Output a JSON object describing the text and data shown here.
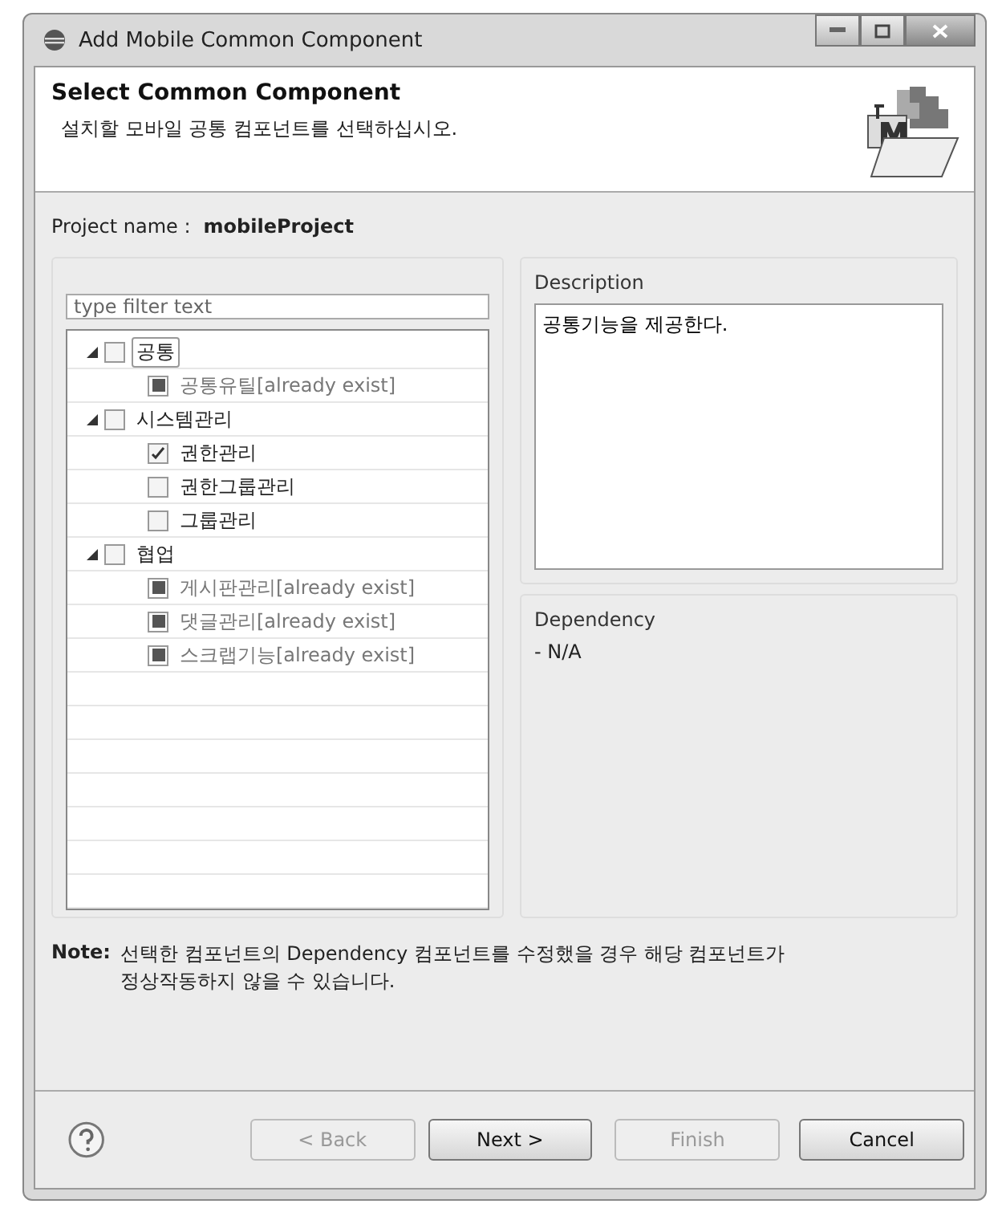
{
  "window": {
    "title": "Add Mobile Common Component"
  },
  "header": {
    "title": "Select Common Component",
    "subtitle": "설치할 모바일 공통 컴포넌트를 선택하십시오."
  },
  "project": {
    "label": "Project name :",
    "value": "mobileProject"
  },
  "filter": {
    "placeholder": "type filter text"
  },
  "tree": [
    {
      "label": "공통",
      "checked": false,
      "exists": false,
      "expanded": true,
      "selected": true,
      "children": [
        {
          "label": "공통유틸[already exist]",
          "exists": true,
          "selected": false
        }
      ]
    },
    {
      "label": "시스템관리",
      "checked": false,
      "exists": false,
      "expanded": true,
      "selected": false,
      "children": [
        {
          "label": "권한관리",
          "checked": true,
          "exists": false,
          "selected": false
        },
        {
          "label": "권한그룹관리",
          "checked": false,
          "exists": false,
          "selected": false
        },
        {
          "label": "그룹관리",
          "checked": false,
          "exists": false,
          "selected": false
        }
      ]
    },
    {
      "label": "협업",
      "checked": false,
      "exists": false,
      "expanded": true,
      "selected": false,
      "children": [
        {
          "label": "게시판관리[already exist]",
          "exists": true,
          "selected": false
        },
        {
          "label": "댓글관리[already exist]",
          "exists": true,
          "selected": false
        },
        {
          "label": "스크랩기능[already exist]",
          "exists": true,
          "selected": false
        }
      ]
    }
  ],
  "description": {
    "label": "Description",
    "text": "공통기능을 제공한다."
  },
  "dependency": {
    "label": "Dependency",
    "text": "- N/A"
  },
  "note": {
    "label": "Note:",
    "text": "선택한 컴포넌트의 Dependency 컴포넌트를 수정했을 경우 해당 컴포넌트가 정상작동하지 않을 수 있습니다."
  },
  "buttons": [
    {
      "label": "< Back",
      "disabled": true
    },
    {
      "label": "Next >",
      "disabled": false
    },
    {
      "label": "Finish",
      "disabled": true
    },
    {
      "label": "Cancel",
      "disabled": false
    }
  ]
}
